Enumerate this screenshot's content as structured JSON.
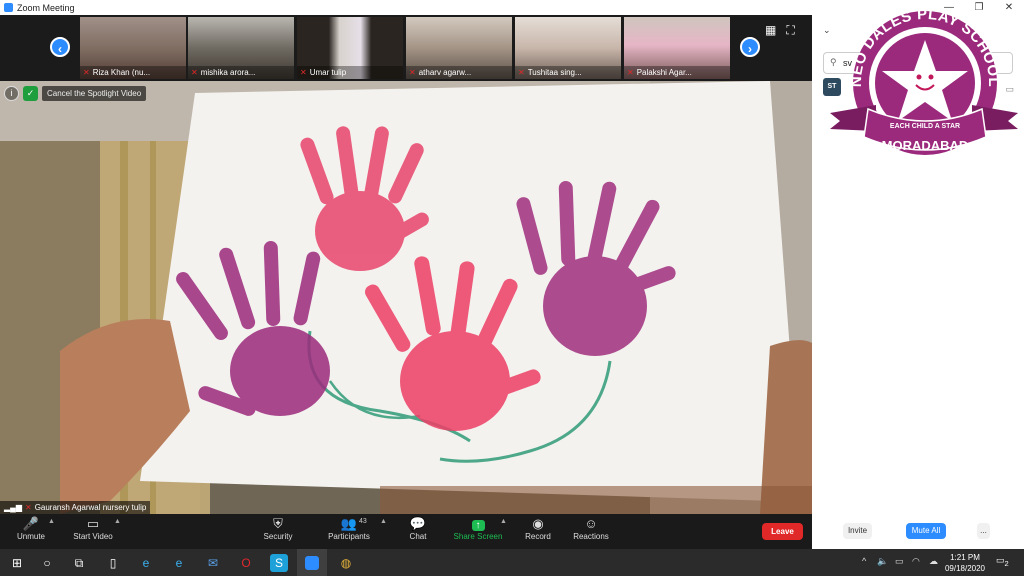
{
  "window": {
    "title": "Zoom Meeting",
    "controls": [
      "—",
      "❐",
      "✕"
    ]
  },
  "gallery": {
    "prev_icon": "‹",
    "next_icon": "›",
    "tiles": [
      {
        "name": "Riza Khan (nu..."
      },
      {
        "name": "mishika arora..."
      },
      {
        "name": "Umar tulip"
      },
      {
        "name": "atharv agarw..."
      },
      {
        "name": "Tushitaa sing..."
      },
      {
        "name": "Palakshi Agar..."
      }
    ],
    "grid_icon": "▦",
    "fullscreen_icon": "⛶"
  },
  "main": {
    "spotlight_button": "Cancel the Spotlight Video",
    "info_icon": "i",
    "shield_icon": "✓",
    "speaker_name": "Gauransh Agarwal nursery tulip"
  },
  "toolbar": {
    "unmute": "Unmute",
    "start_video": "Start Video",
    "security": "Security",
    "participants": "Participants",
    "participant_count": "43",
    "chat": "Chat",
    "share_screen": "Share Screen",
    "record": "Record",
    "reactions": "Reactions",
    "leave": "Leave"
  },
  "panel": {
    "search_value": "sv",
    "participant_initials": "ST",
    "invite": "Invite",
    "mute_all": "Mute All",
    "more": "..."
  },
  "logo": {
    "top_text": "NEO DALES PLAY SCHOOL",
    "motto": "EACH CHILD A STAR",
    "city": "MORADABAD",
    "colors": {
      "primary": "#9c2a7c",
      "star": "#ffffff",
      "face": "#c2185b"
    }
  },
  "taskbar": {
    "time": "1:21 PM",
    "date": "09/18/2020",
    "notifications": "2"
  },
  "colors": {
    "accent": "#2d8cff",
    "leave": "#e02828",
    "share": "#1ebd53"
  }
}
